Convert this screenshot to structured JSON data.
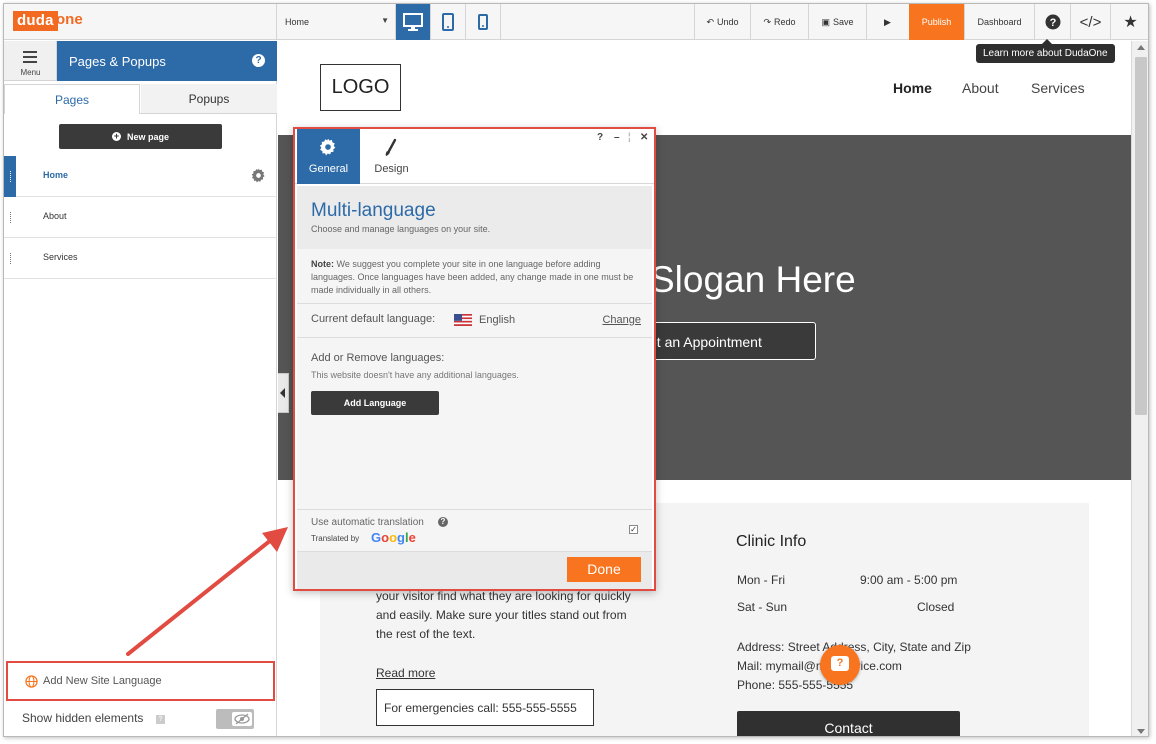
{
  "topbar": {
    "logo_part1": "duda",
    "logo_part2": "one",
    "page_select": "Home",
    "undo": "Undo",
    "redo": "Redo",
    "save": "Save",
    "publish": "Publish",
    "dashboard": "Dashboard",
    "tooltip": "Learn more about DudaOne"
  },
  "left_panel": {
    "menu_label": "Menu",
    "title": "Pages & Popups",
    "tabs": [
      "Pages",
      "Popups"
    ],
    "new_page": "New page",
    "pages": [
      {
        "name": "Home",
        "active": true
      },
      {
        "name": "About",
        "active": false
      },
      {
        "name": "Services",
        "active": false
      }
    ],
    "add_language": "Add New Site Language",
    "show_hidden": "Show hidden elements"
  },
  "site": {
    "logo": "LOGO",
    "nav": [
      "Home",
      "About",
      "Services"
    ],
    "slogan": "Slogan Here",
    "appointment": "et an Appointment",
    "paragraph": "your visitor find what they are looking for quickly and easily. Make sure your titles stand out from the rest of the text.",
    "read_more": "Read more",
    "emergency": "For emergencies call: 555-555-5555",
    "clinic_title": "Clinic Info",
    "hours": [
      {
        "days": "Mon - Fri",
        "time": "9:00 am - 5:00 pm"
      },
      {
        "days": "Sat - Sun",
        "time": "Closed"
      }
    ],
    "address": "Address: Street Address, City, State and Zip",
    "mail": "Mail: mymail@mailservice.com",
    "phone": "Phone: 555-555-5555",
    "contact": "Contact"
  },
  "modal": {
    "tabs": [
      "General",
      "Design"
    ],
    "title": "Multi-language",
    "subtitle": "Choose and manage languages on your site.",
    "note_label": "Note:",
    "note": "We suggest you complete your site in one language before adding languages. Once languages have been added, any change made in one must be made individually in all others.",
    "current_default_label": "Current default language:",
    "current_language": "English",
    "change": "Change",
    "add_remove_title": "Add or Remove languages:",
    "add_remove_sub": "This website doesn't have any additional languages.",
    "add_language_button": "Add Language",
    "auto_translate": "Use automatic translation",
    "translated_by": "Translated by",
    "google": "Google",
    "auto_translate_checked": true,
    "done": "Done"
  },
  "colors": {
    "accent_blue": "#2c6aa8",
    "orange": "#f8741e",
    "highlight_red": "#e24b41"
  }
}
